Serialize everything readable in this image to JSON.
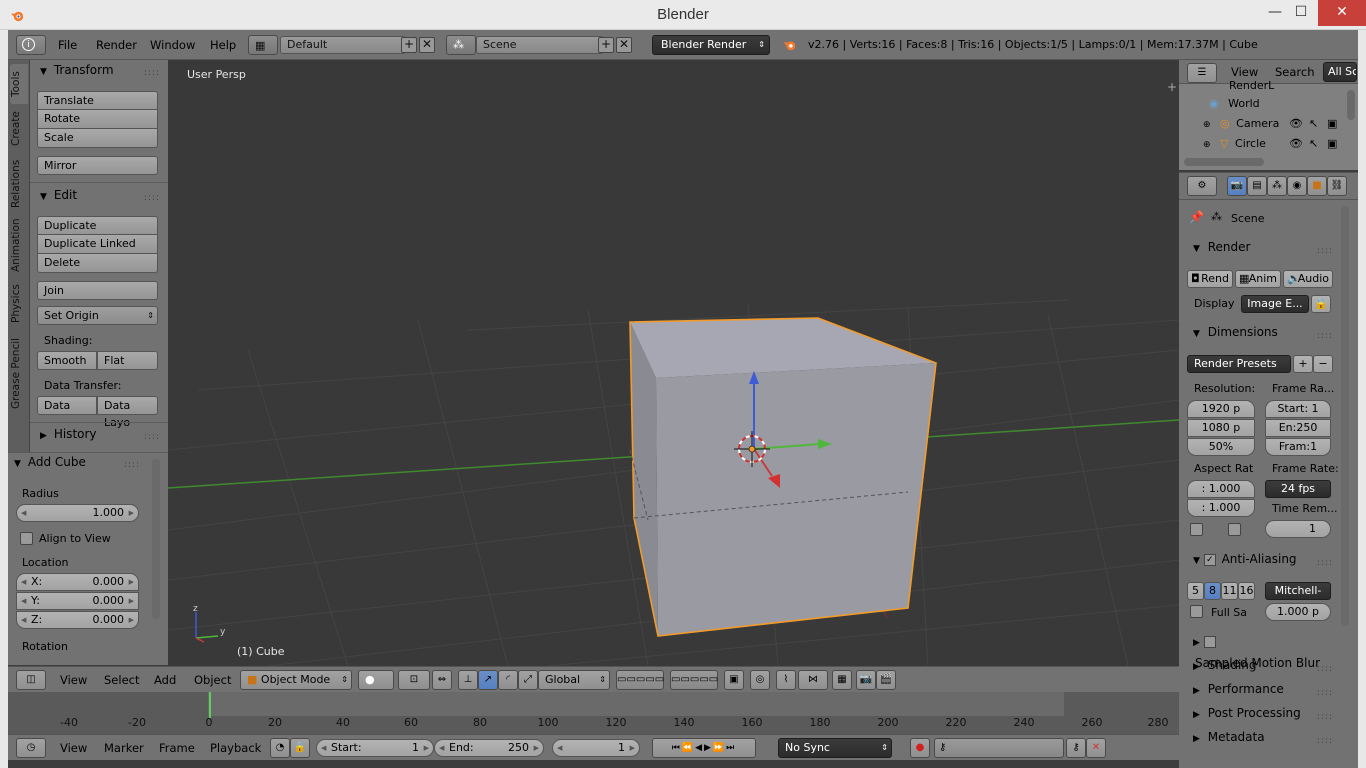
{
  "window": {
    "title": "Blender",
    "minimize": "—",
    "maximize": "☐",
    "close": "✕"
  },
  "info": {
    "menus": [
      "File",
      "Render",
      "Window",
      "Help"
    ],
    "layout": "Default",
    "scene": "Scene",
    "engine": "Blender Render",
    "stats": "v2.76 | Verts:16 | Faces:8 | Tris:16 | Objects:1/5 | Lamps:0/1 | Mem:17.37M | Cube"
  },
  "tabs": [
    "Tools",
    "Create",
    "Relations",
    "Animation",
    "Physics",
    "Grease Pencil"
  ],
  "tools": {
    "transform_title": "Transform",
    "translate": "Translate",
    "rotate": "Rotate",
    "scale": "Scale",
    "mirror": "Mirror",
    "edit_title": "Edit",
    "duplicate": "Duplicate",
    "duplicate_linked": "Duplicate Linked",
    "delete": "Delete",
    "join": "Join",
    "set_origin": "Set Origin",
    "shading_label": "Shading:",
    "smooth": "Smooth",
    "flat": "Flat",
    "data_transfer_label": "Data Transfer:",
    "data": "Data",
    "data_layout": "Data Layo",
    "history_title": "History"
  },
  "operator": {
    "title": "Add Cube",
    "radius_label": "Radius",
    "radius": "1.000",
    "align_label": "Align to View",
    "location_label": "Location",
    "x_label": "X:",
    "x": "0.000",
    "y_label": "Y:",
    "y": "0.000",
    "z_label": "Z:",
    "z": "0.000",
    "rotation_label": "Rotation"
  },
  "viewport": {
    "view_name": "User Persp",
    "object_name": "(1) Cube",
    "axis_y": "y",
    "axis_z": "z"
  },
  "view_header": {
    "menus": [
      "View",
      "Select",
      "Add",
      "Object"
    ],
    "mode": "Object Mode",
    "orientation": "Global"
  },
  "timeline": {
    "ticks": [
      "-40",
      "-20",
      "0",
      "20",
      "40",
      "60",
      "80",
      "100",
      "120",
      "140",
      "160",
      "180",
      "200",
      "220",
      "240",
      "260",
      "280"
    ],
    "menus": [
      "View",
      "Marker",
      "Frame",
      "Playback"
    ],
    "start_label": "Start:",
    "start": "1",
    "end_label": "End:",
    "end": "250",
    "current": "1",
    "sync": "No Sync"
  },
  "outliner": {
    "menus": [
      "View",
      "Search"
    ],
    "filter": "All Sc",
    "rows": [
      "RenderL",
      "World",
      "Camera",
      "Circle"
    ]
  },
  "properties": {
    "context": "Scene",
    "render_title": "Render",
    "render_btn": "Rend",
    "anim_btn": "Anim",
    "audio_btn": "Audio",
    "display_label": "Display",
    "display_value": "Image E...",
    "dimensions_title": "Dimensions",
    "presets": "Render Presets",
    "resolution_label": "Resolution:",
    "res_x": "1920 p",
    "res_y": "1080 p",
    "res_pct": "50%",
    "frame_range_label": "Frame Ra...",
    "frame_start": "Start: 1",
    "frame_end": "En:250",
    "frame_step": "Fram:1",
    "aspect_label": "Aspect Rat",
    "aspect_x": ": 1.000",
    "aspect_y": ": 1.000",
    "frame_rate_label": "Frame Rate:",
    "fps": "24 fps",
    "time_remap_label": "Time Rem...",
    "time_remap": "1",
    "aa_title": "Anti-Aliasing",
    "aa_samples": [
      "5",
      "8",
      "11",
      "16"
    ],
    "aa_filter": "Mitchell-",
    "full_sample_label": "Full Sa",
    "filter_size": "1.000 p",
    "collapsed": [
      "Sampled Motion Blur",
      "Shading",
      "Performance",
      "Post Processing",
      "Metadata"
    ]
  },
  "colors": {
    "selection": "#f29b2b",
    "x_axis": "#c93a3a",
    "y_axis": "#4fb83c",
    "z_axis": "#3d5cd6"
  }
}
